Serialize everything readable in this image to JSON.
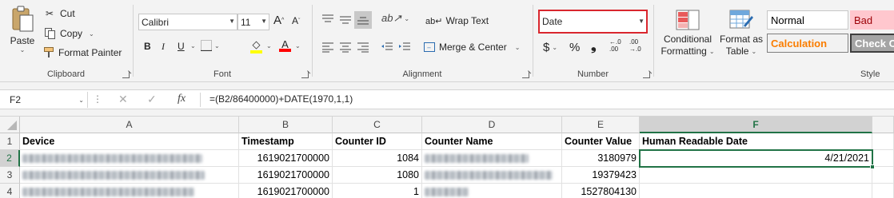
{
  "ribbon": {
    "clipboard": {
      "label": "Clipboard",
      "paste": "Paste",
      "cut": "Cut",
      "copy": "Copy",
      "format_painter": "Format Painter"
    },
    "font": {
      "label": "Font",
      "font_name": "Calibri",
      "font_size": "11",
      "bold": "B",
      "italic": "I",
      "underline": "U"
    },
    "alignment": {
      "label": "Alignment",
      "wrap_text": "Wrap Text",
      "merge_center": "Merge & Center"
    },
    "number": {
      "label": "Number",
      "format": "Date",
      "currency": "$",
      "percent": "%",
      "comma": "❟",
      "inc_decimal": "←.0\n.00",
      "dec_decimal": ".00\n→.0"
    },
    "styles": {
      "label": "Style",
      "conditional_formatting": [
        "Conditional",
        "Formatting"
      ],
      "format_as_table": [
        "Format as",
        "Table"
      ],
      "normal": "Normal",
      "bad": "Bad",
      "calculation": "Calculation",
      "check_cell": "Check C"
    }
  },
  "formula_bar": {
    "name_box": "F2",
    "fx": "fx",
    "formula": "=(B2/86400000)+DATE(1970,1,1)"
  },
  "grid": {
    "columns": [
      "A",
      "B",
      "C",
      "D",
      "E",
      "F"
    ],
    "rows": [
      "1",
      "2",
      "3",
      "4"
    ],
    "header_row": [
      "Device",
      "Timestamp",
      "Counter ID",
      "Counter Name",
      "Counter Value",
      "Human Readable Date"
    ],
    "data": [
      {
        "timestamp": "1619021700000",
        "counter_id": "1084",
        "counter_value": "3180979",
        "date": "4/21/2021"
      },
      {
        "timestamp": "1619021700000",
        "counter_id": "1080",
        "counter_value": "19379423",
        "date": ""
      },
      {
        "timestamp": "1619021700000",
        "counter_id": "1",
        "counter_value": "1527804130",
        "date": ""
      }
    ]
  },
  "colors": {
    "excel_green": "#217346",
    "number_format_highlight": "#d9272e",
    "bad_fill": "#ffc7ce",
    "bad_text": "#9c0006",
    "calculation_text": "#fa7d00",
    "check_cell_fill": "#a5a5a5"
  }
}
